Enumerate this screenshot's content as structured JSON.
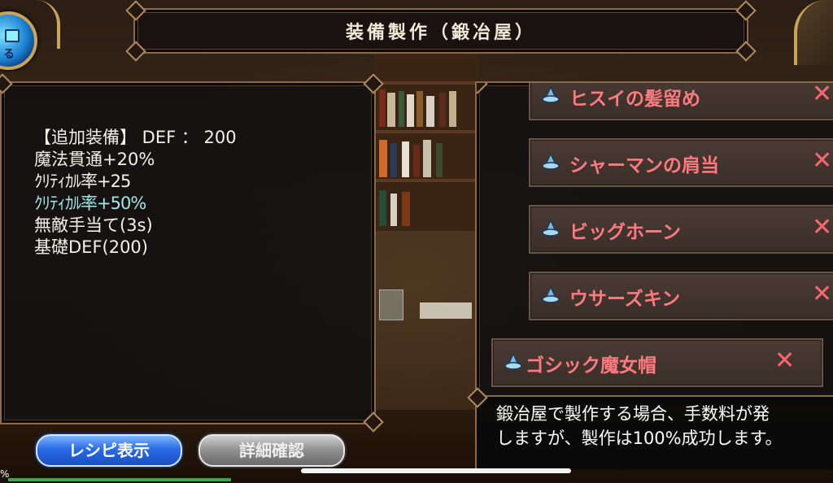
{
  "header": {
    "title": "装備製作（鍛冶屋）",
    "back_button_glyph": "る"
  },
  "stats": {
    "lines": [
      "【追加装備】 DEF ： 200",
      "魔法貫通+20%",
      "ｸﾘﾃｨｶﾙ率+25",
      "ｸﾘﾃｨｶﾙ率+50%",
      "無敵手当て(3s)",
      "基礎DEF(200)"
    ]
  },
  "materials": {
    "items": [
      {
        "label": "ヒスイの髪留め",
        "status": "✕",
        "icon": "wizard-hat-icon"
      },
      {
        "label": "シャーマンの肩当",
        "status": "✕",
        "icon": "wizard-hat-icon"
      },
      {
        "label": "ビッグホーン",
        "status": "✕",
        "icon": "wizard-hat-icon"
      },
      {
        "label": "ウサーズキン",
        "status": "✕",
        "icon": "wizard-hat-icon"
      },
      {
        "label": "ゴシック魔女帽",
        "status": "✕",
        "icon": "wizard-hat-icon"
      }
    ]
  },
  "message": {
    "line1": "鍛冶屋で製作する場合、手数料が発",
    "line2": "しますが、製作は100%成功します。"
  },
  "buttons": {
    "recipe": "レシピ表示",
    "details": "詳細確認"
  },
  "progress": {
    "label": "%",
    "fraction": 0.27
  },
  "colors": {
    "material_text": "#ff7a80",
    "highlight_stat": "#9fe6e8",
    "frame": "#8a6a48"
  }
}
